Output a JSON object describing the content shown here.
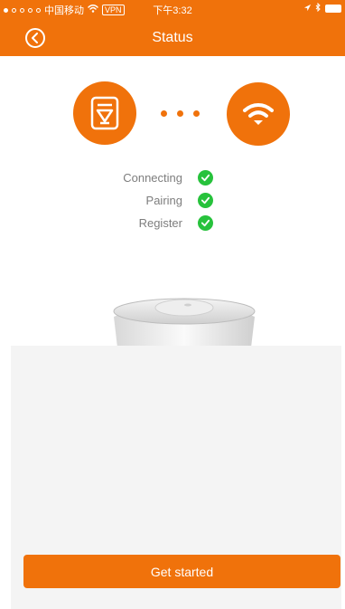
{
  "status_bar": {
    "carrier": "中国移动",
    "vpn": "VPN",
    "time": "下午3:32",
    "signal_bars": [
      1,
      0,
      0,
      0,
      0
    ]
  },
  "nav": {
    "title": "Status",
    "back_icon": "chevron-left-icon"
  },
  "connection": {
    "left_icon": "device-icon",
    "right_icon": "wifi-icon",
    "dots": 3
  },
  "steps": [
    {
      "label": "Connecting",
      "status": "done"
    },
    {
      "label": "Pairing",
      "status": "done"
    },
    {
      "label": "Register",
      "status": "done"
    }
  ],
  "actions": {
    "get_started": "Get started"
  },
  "colors": {
    "accent": "#f0720b",
    "success": "#27c23c",
    "panel": "#f4f4f4",
    "label": "#7d7d7d"
  }
}
